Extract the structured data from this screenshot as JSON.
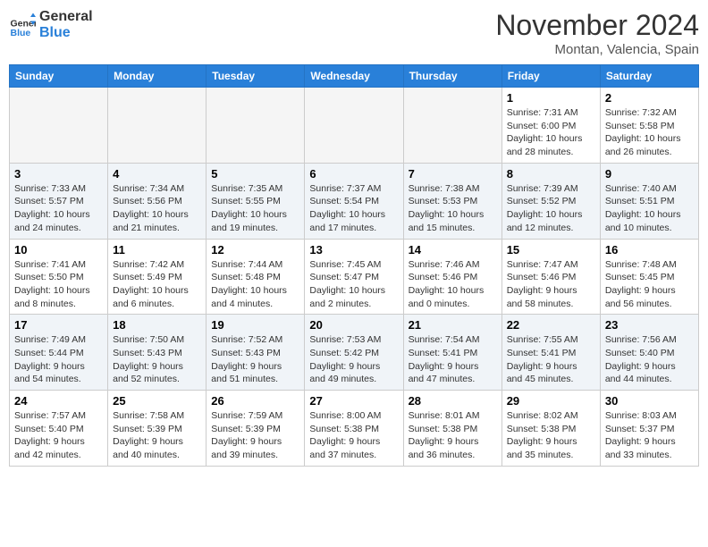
{
  "header": {
    "logo_general": "General",
    "logo_blue": "Blue",
    "month_year": "November 2024",
    "location": "Montan, Valencia, Spain"
  },
  "weekdays": [
    "Sunday",
    "Monday",
    "Tuesday",
    "Wednesday",
    "Thursday",
    "Friday",
    "Saturday"
  ],
  "weeks": [
    [
      {
        "day": "",
        "empty": true
      },
      {
        "day": "",
        "empty": true
      },
      {
        "day": "",
        "empty": true
      },
      {
        "day": "",
        "empty": true
      },
      {
        "day": "",
        "empty": true
      },
      {
        "day": "1",
        "sunrise": "7:31 AM",
        "sunset": "6:00 PM",
        "daylight": "10 hours and 28 minutes."
      },
      {
        "day": "2",
        "sunrise": "7:32 AM",
        "sunset": "5:58 PM",
        "daylight": "10 hours and 26 minutes."
      }
    ],
    [
      {
        "day": "3",
        "sunrise": "7:33 AM",
        "sunset": "5:57 PM",
        "daylight": "10 hours and 24 minutes."
      },
      {
        "day": "4",
        "sunrise": "7:34 AM",
        "sunset": "5:56 PM",
        "daylight": "10 hours and 21 minutes."
      },
      {
        "day": "5",
        "sunrise": "7:35 AM",
        "sunset": "5:55 PM",
        "daylight": "10 hours and 19 minutes."
      },
      {
        "day": "6",
        "sunrise": "7:37 AM",
        "sunset": "5:54 PM",
        "daylight": "10 hours and 17 minutes."
      },
      {
        "day": "7",
        "sunrise": "7:38 AM",
        "sunset": "5:53 PM",
        "daylight": "10 hours and 15 minutes."
      },
      {
        "day": "8",
        "sunrise": "7:39 AM",
        "sunset": "5:52 PM",
        "daylight": "10 hours and 12 minutes."
      },
      {
        "day": "9",
        "sunrise": "7:40 AM",
        "sunset": "5:51 PM",
        "daylight": "10 hours and 10 minutes."
      }
    ],
    [
      {
        "day": "10",
        "sunrise": "7:41 AM",
        "sunset": "5:50 PM",
        "daylight": "10 hours and 8 minutes."
      },
      {
        "day": "11",
        "sunrise": "7:42 AM",
        "sunset": "5:49 PM",
        "daylight": "10 hours and 6 minutes."
      },
      {
        "day": "12",
        "sunrise": "7:44 AM",
        "sunset": "5:48 PM",
        "daylight": "10 hours and 4 minutes."
      },
      {
        "day": "13",
        "sunrise": "7:45 AM",
        "sunset": "5:47 PM",
        "daylight": "10 hours and 2 minutes."
      },
      {
        "day": "14",
        "sunrise": "7:46 AM",
        "sunset": "5:46 PM",
        "daylight": "10 hours and 0 minutes."
      },
      {
        "day": "15",
        "sunrise": "7:47 AM",
        "sunset": "5:46 PM",
        "daylight": "9 hours and 58 minutes."
      },
      {
        "day": "16",
        "sunrise": "7:48 AM",
        "sunset": "5:45 PM",
        "daylight": "9 hours and 56 minutes."
      }
    ],
    [
      {
        "day": "17",
        "sunrise": "7:49 AM",
        "sunset": "5:44 PM",
        "daylight": "9 hours and 54 minutes."
      },
      {
        "day": "18",
        "sunrise": "7:50 AM",
        "sunset": "5:43 PM",
        "daylight": "9 hours and 52 minutes."
      },
      {
        "day": "19",
        "sunrise": "7:52 AM",
        "sunset": "5:43 PM",
        "daylight": "9 hours and 51 minutes."
      },
      {
        "day": "20",
        "sunrise": "7:53 AM",
        "sunset": "5:42 PM",
        "daylight": "9 hours and 49 minutes."
      },
      {
        "day": "21",
        "sunrise": "7:54 AM",
        "sunset": "5:41 PM",
        "daylight": "9 hours and 47 minutes."
      },
      {
        "day": "22",
        "sunrise": "7:55 AM",
        "sunset": "5:41 PM",
        "daylight": "9 hours and 45 minutes."
      },
      {
        "day": "23",
        "sunrise": "7:56 AM",
        "sunset": "5:40 PM",
        "daylight": "9 hours and 44 minutes."
      }
    ],
    [
      {
        "day": "24",
        "sunrise": "7:57 AM",
        "sunset": "5:40 PM",
        "daylight": "9 hours and 42 minutes."
      },
      {
        "day": "25",
        "sunrise": "7:58 AM",
        "sunset": "5:39 PM",
        "daylight": "9 hours and 40 minutes."
      },
      {
        "day": "26",
        "sunrise": "7:59 AM",
        "sunset": "5:39 PM",
        "daylight": "9 hours and 39 minutes."
      },
      {
        "day": "27",
        "sunrise": "8:00 AM",
        "sunset": "5:38 PM",
        "daylight": "9 hours and 37 minutes."
      },
      {
        "day": "28",
        "sunrise": "8:01 AM",
        "sunset": "5:38 PM",
        "daylight": "9 hours and 36 minutes."
      },
      {
        "day": "29",
        "sunrise": "8:02 AM",
        "sunset": "5:38 PM",
        "daylight": "9 hours and 35 minutes."
      },
      {
        "day": "30",
        "sunrise": "8:03 AM",
        "sunset": "5:37 PM",
        "daylight": "9 hours and 33 minutes."
      }
    ]
  ]
}
